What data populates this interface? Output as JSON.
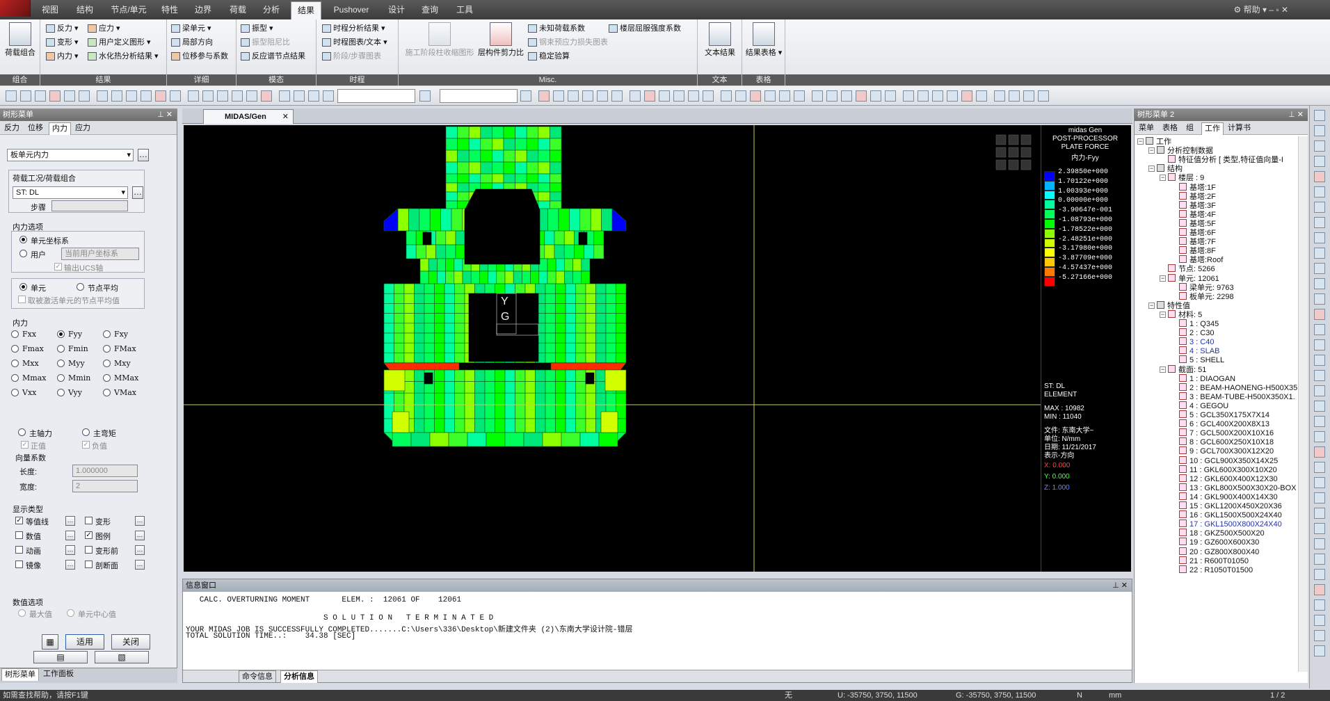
{
  "menubar": {
    "tabs": [
      "视图",
      "结构",
      "节点/单元",
      "特性",
      "边界",
      "荷载",
      "分析",
      "结果",
      "Pushover",
      "设计",
      "查询",
      "工具"
    ],
    "active": "结果",
    "help": "帮助"
  },
  "ribbon": {
    "groups": [
      {
        "caption": "组合",
        "items": [
          "荷载组合"
        ]
      },
      {
        "caption": "结果",
        "items": [
          "反力",
          "应力",
          "变形",
          "用户定义图形",
          "内力",
          "水化热分析结果"
        ]
      },
      {
        "caption": "详细",
        "items": [
          "梁单元",
          "局部方向",
          "位移参与系数"
        ]
      },
      {
        "caption": "模态",
        "items": [
          "振型",
          "振型阻尼比",
          "反应谱节点结果"
        ]
      },
      {
        "caption": "时程",
        "items": [
          "时程分析结果",
          "时程图表/文本",
          "阶段/步骤图表"
        ]
      },
      {
        "caption": "Misc.",
        "items": [
          "施工阶段柱收缩图形",
          "层构件剪力比",
          "未知荷载系数",
          "钢束预应力损失图表",
          "稳定验算",
          "楼层屈服强度系数"
        ]
      },
      {
        "caption": "文本",
        "items": [
          "文本结果"
        ]
      },
      {
        "caption": "表格",
        "items": [
          "结果表格"
        ]
      }
    ]
  },
  "left_panel": {
    "title": "树形菜单",
    "tabs": [
      "反力",
      "位移",
      "内力",
      "应力"
    ],
    "active_tab": "内力",
    "type_select": "板单元内力",
    "lc_label": "荷载工况/荷载组合",
    "lc_value": "ST: DL",
    "step_label": "步骤",
    "force_opt_label": "内力选项",
    "coord_elem": "单元坐标系",
    "coord_user": "用户",
    "user_cs": "当前用户坐标系",
    "ucs_axis": "输出UCS轴",
    "elem": "单元",
    "node_avg": "节点平均",
    "active_avg": "取被激活单元的节点平均值",
    "force_label": "内力",
    "forces": [
      "Fxx",
      "Fyy",
      "Fxy",
      "Fmax",
      "Fmin",
      "FMax",
      "Mxx",
      "Myy",
      "Mxy",
      "Mmax",
      "Mmin",
      "MMax",
      "Vxx",
      "Vyy",
      "VMax"
    ],
    "force_selected": "Fyy",
    "principal_axial": "主轴力",
    "principal_moment": "主弯矩",
    "positive": "正值",
    "negative": "负值",
    "vector_label": "向量系数",
    "length_label": "长度:",
    "length_value": "1.000000",
    "width_label": "宽度:",
    "width_value": "2",
    "display_label": "显示类型",
    "display": [
      "等值线",
      "变形",
      "数值",
      "图例",
      "动画",
      "变形前",
      "镜像",
      "剖断面"
    ],
    "numopt_label": "数值选项",
    "max_val": "最大值",
    "center_val": "单元中心值",
    "apply": "适用",
    "close": "关闭",
    "bottom_tabs": [
      "树形菜单",
      "工作面板"
    ]
  },
  "doc": {
    "tab": "MIDAS/Gen"
  },
  "legend": {
    "header": [
      "midas Gen",
      "POST-PROCESSOR",
      "PLATE FORCE",
      "内力-Fyy"
    ],
    "values": [
      "2.39850e+000",
      "1.70122e+000",
      "1.00393e+000",
      "0.00000e+000",
      "-3.90647e-001",
      "-1.08793e+000",
      "-1.78522e+000",
      "-2.48251e+000",
      "-3.17980e+000",
      "-3.87709e+000",
      "-4.57437e+000",
      "-5.27166e+000"
    ],
    "colors": [
      "#0000ff",
      "#00b4ff",
      "#00ffff",
      "#00ffa0",
      "#00ff5a",
      "#00ff00",
      "#8cff00",
      "#d2ff00",
      "#ffff00",
      "#ffc800",
      "#ff7800",
      "#ff0000"
    ],
    "lc": "ST: DL",
    "elem": "ELEMENT",
    "max": "MAX : 10982",
    "min": "MIN : 11040",
    "file": "文件: 东南大学~",
    "unit": "单位: N/mm",
    "date": "日期: 11/21/2017",
    "dir": "表示-方向",
    "x": "X: 0.000",
    "y": "Y: 0.000",
    "z": "Z: 1.000"
  },
  "message": {
    "title": "信息窗口",
    "lines": [
      "   CALC. OVERTURNING MOMENT       ELEM. :  12061 OF    12061",
      "",
      "                              S O L U T I O N   T E R M I N A T E D",
      "YOUR MIDAS JOB IS SUCCESSFULLY COMPLETED.......C:\\Users\\336\\Desktop\\新建文件夹 (2)\\东南大学设计院-错层",
      "TOTAL SOLUTION TIME..:    34.38 [SEC]"
    ],
    "tabs": [
      "命令信息",
      "分析信息"
    ]
  },
  "right_panel": {
    "title": "树形菜单 2",
    "tabs": [
      "菜单",
      "表格",
      "组",
      "工作",
      "计算书"
    ],
    "active_tab": "工作",
    "tree": [
      {
        "t": "工作",
        "l": 0
      },
      {
        "t": "分析控制数据",
        "l": 1
      },
      {
        "t": "特征值分析 [ 类型,特征值向量-I",
        "l": 2
      },
      {
        "t": "结构",
        "l": 1
      },
      {
        "t": "楼层 : 9",
        "l": 2
      },
      {
        "t": "基塔:1F",
        "l": 3
      },
      {
        "t": "基塔:2F",
        "l": 3
      },
      {
        "t": "基塔:3F",
        "l": 3
      },
      {
        "t": "基塔:4F",
        "l": 3
      },
      {
        "t": "基塔:5F",
        "l": 3
      },
      {
        "t": "基塔:6F",
        "l": 3
      },
      {
        "t": "基塔:7F",
        "l": 3
      },
      {
        "t": "基塔:8F",
        "l": 3
      },
      {
        "t": "基塔:Roof",
        "l": 3
      },
      {
        "t": "节点: 5266",
        "l": 2
      },
      {
        "t": "单元: 12061",
        "l": 2
      },
      {
        "t": "梁单元: 9763",
        "l": 3
      },
      {
        "t": "板单元: 2298",
        "l": 3
      },
      {
        "t": "特性值",
        "l": 1
      },
      {
        "t": "材料: 5",
        "l": 2
      },
      {
        "t": "1 : Q345",
        "l": 3
      },
      {
        "t": "2 : C30",
        "l": 3
      },
      {
        "t": "3 : C40",
        "l": 3,
        "b": true
      },
      {
        "t": "4 : SLAB",
        "l": 3,
        "b": true
      },
      {
        "t": "5 : SHELL",
        "l": 3
      },
      {
        "t": "截面: 51",
        "l": 2
      },
      {
        "t": "1 : DIAOGAN",
        "l": 3
      },
      {
        "t": "2 : BEAM-HAONENG-H500X350X",
        "l": 3
      },
      {
        "t": "3 : BEAM-TUBE-H500X350X1.",
        "l": 3
      },
      {
        "t": "4 : GEGOU",
        "l": 3
      },
      {
        "t": "5 : GCL350X175X7X14",
        "l": 3
      },
      {
        "t": "6 : GCL400X200X8X13",
        "l": 3
      },
      {
        "t": "7 : GCL500X200X10X16",
        "l": 3
      },
      {
        "t": "8 : GCL600X250X10X18",
        "l": 3
      },
      {
        "t": "9 : GCL700X300X12X20",
        "l": 3
      },
      {
        "t": "10 : GCL900X350X14X25",
        "l": 3
      },
      {
        "t": "11 : GKL600X300X10X20",
        "l": 3
      },
      {
        "t": "12 : GKL600X400X12X30",
        "l": 3
      },
      {
        "t": "13 : GKL800X500X30X20-BOX",
        "l": 3
      },
      {
        "t": "14 : GKL900X400X14X30",
        "l": 3
      },
      {
        "t": "15 : GKL1200X450X20X36",
        "l": 3
      },
      {
        "t": "16 : GKL1500X500X24X40",
        "l": 3
      },
      {
        "t": "17 : GKL1500X800X24X40",
        "l": 3,
        "b": true
      },
      {
        "t": "18 : GKZ500X500X20",
        "l": 3
      },
      {
        "t": "19 : GZ600X600X30",
        "l": 3
      },
      {
        "t": "20 : GZ800X800X40",
        "l": 3
      },
      {
        "t": "21 : R600T01050",
        "l": 3
      },
      {
        "t": "22 : R1050T01500",
        "l": 3
      }
    ]
  },
  "status": {
    "hint": "如需查找帮助，请按F1键",
    "none": "无",
    "u": "U: -35750, 3750, 11500",
    "g": "G: -35750, 3750, 11500",
    "unit1": "N",
    "unit2": "mm",
    "page": "1 / 2"
  }
}
